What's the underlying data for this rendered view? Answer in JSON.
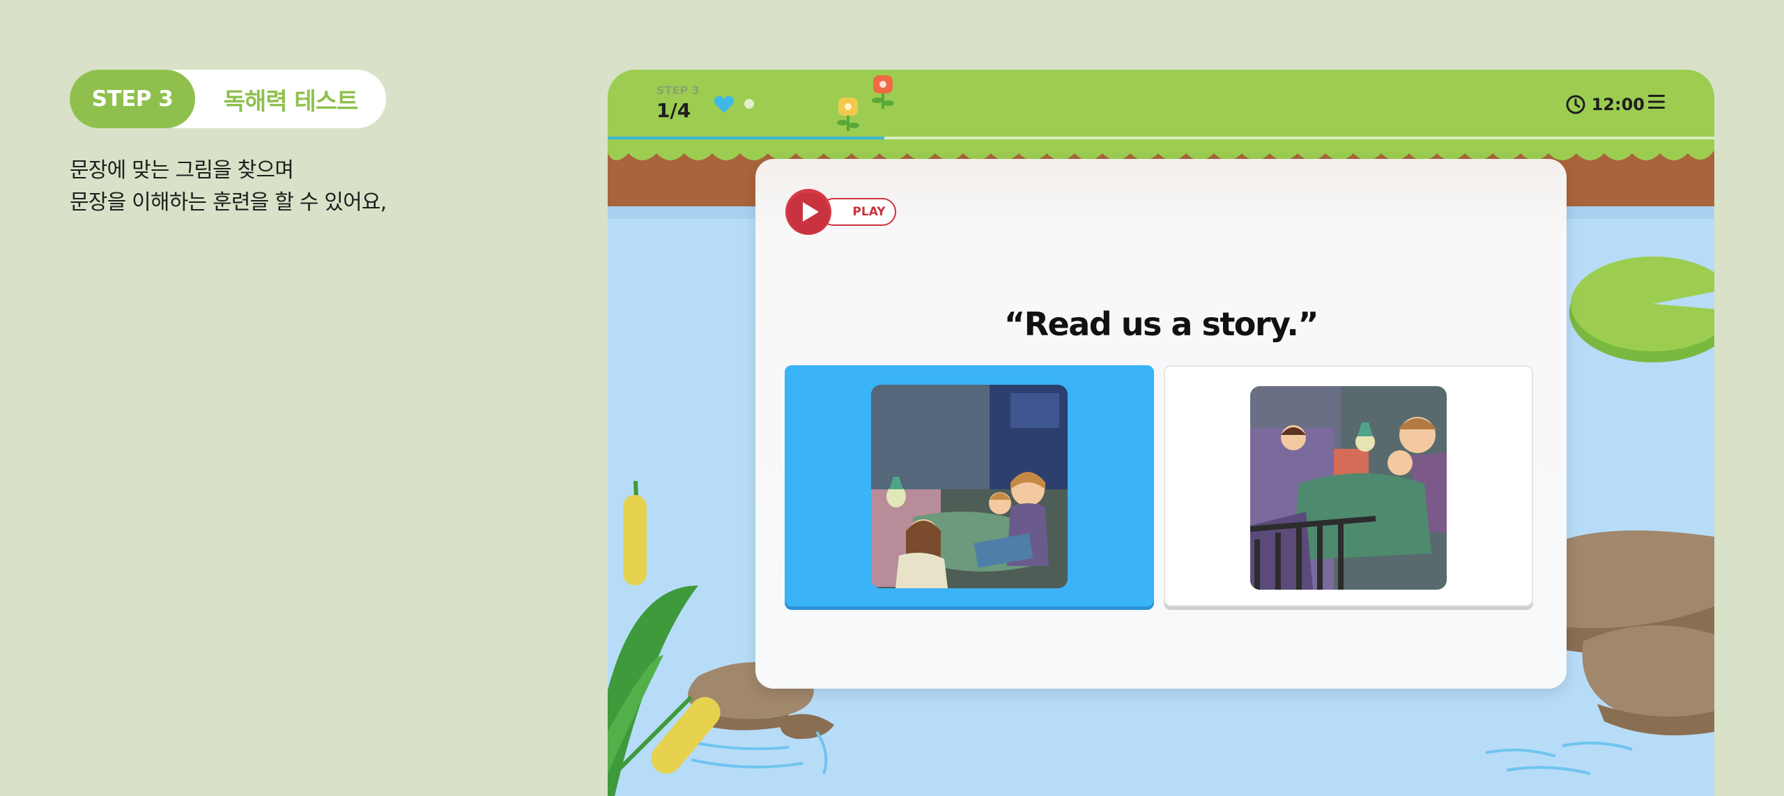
{
  "intro": {
    "step_badge": "STEP 3",
    "step_title": "독해력 테스트",
    "description_line1": "문장에 맞는 그림을 찾으며",
    "description_line2": "문장을 이해하는 훈련을 할 수 있어요,"
  },
  "game": {
    "step_small": "STEP 3",
    "counter": "1/4",
    "progress": 0.25,
    "timer": "12:00",
    "play_label": "PLAY",
    "sentence": "“Read us a story.”",
    "choices": [
      {
        "illustration": "mother-reading-book-to-children-illustration",
        "selected": true
      },
      {
        "illustration": "mother-tucking-children-into-bed-illustration",
        "selected": false
      }
    ],
    "colors": {
      "accent_green": "#8fc04d",
      "selected_blue": "#3ab3f7",
      "play_red": "#c9323f",
      "pond_blue": "#b7dcf8"
    }
  }
}
